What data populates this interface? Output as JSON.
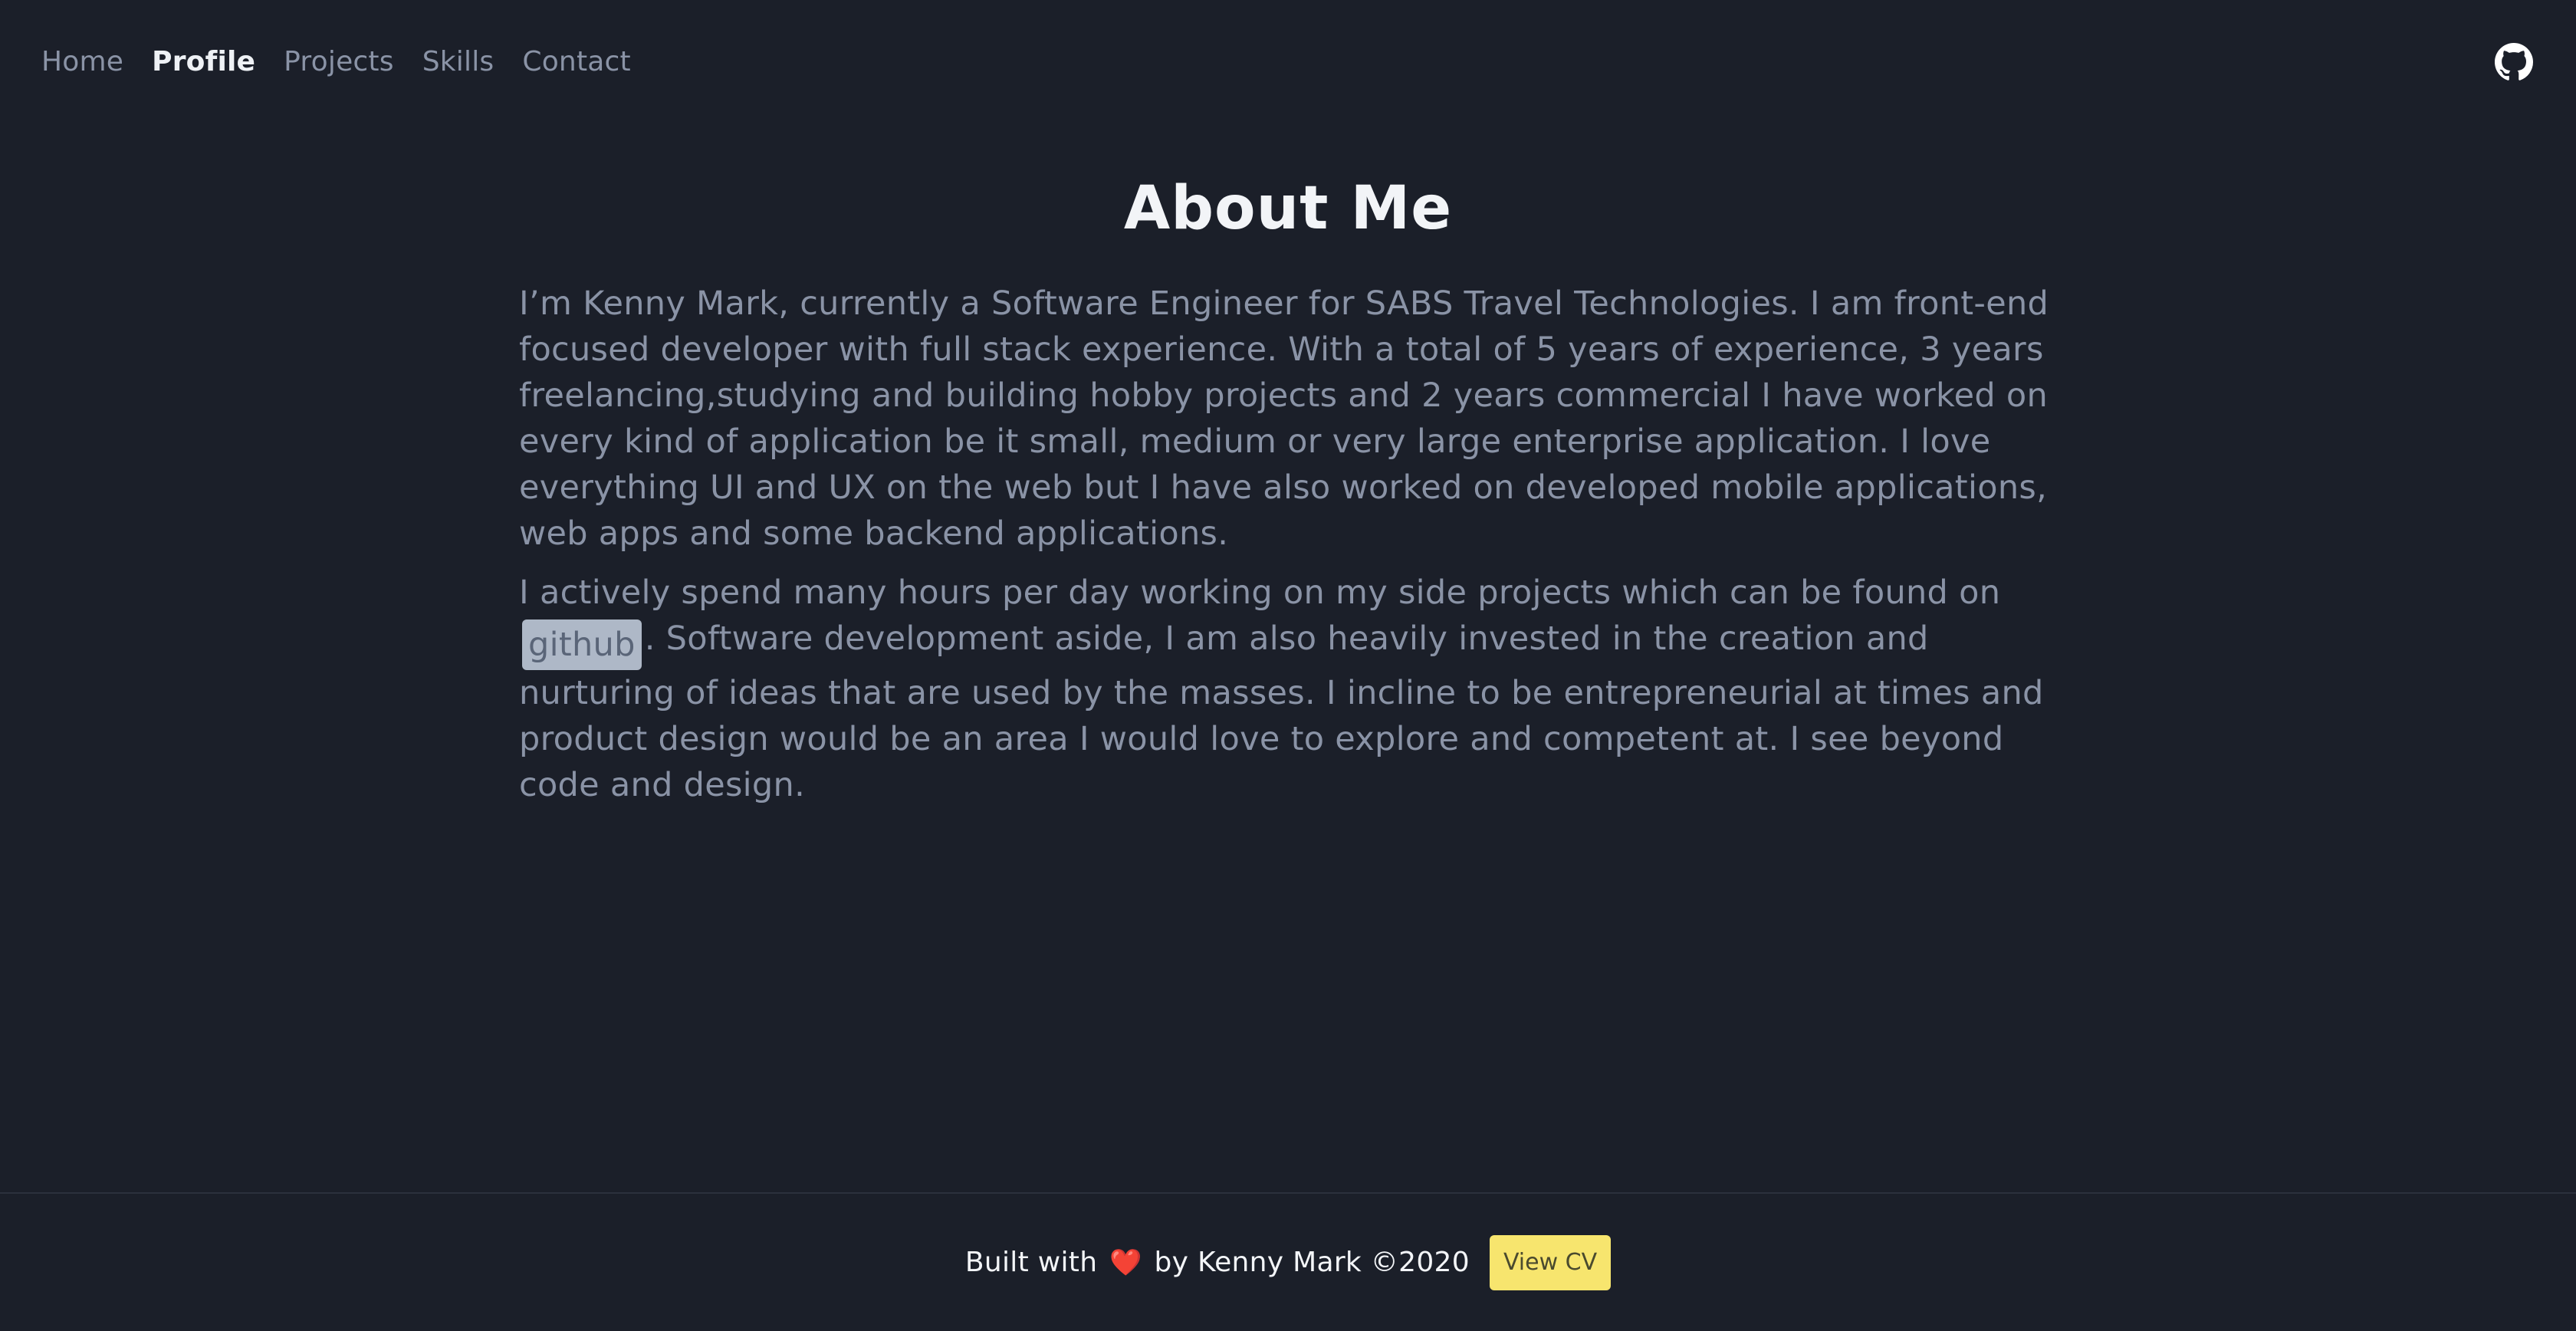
{
  "nav": {
    "items": [
      {
        "label": "Home",
        "active": false
      },
      {
        "label": "Profile",
        "active": true
      },
      {
        "label": "Projects",
        "active": false
      },
      {
        "label": "Skills",
        "active": false
      },
      {
        "label": "Contact",
        "active": false
      }
    ],
    "github_icon": "github-icon"
  },
  "main": {
    "title": "About Me",
    "paragraph1": "I’m Kenny Mark, currently a Software Engineer for SABS Travel Technologies. I am front-end focused developer with full stack experience. With a total of 5 years of experience, 3 years freelancing,studying and building hobby projects and 2 years commercial I have worked on every kind of application be it small, medium or very large enterprise application. I love everything UI and UX on the web but I have also worked on developed mobile applications, web apps and some backend applications.",
    "paragraph2_before": "I actively spend many hours per day working on my side projects which can be found on",
    "github_link": "github",
    "paragraph2_after": ". Software development aside, I am also heavily invested in the creation and nurturing of ideas that are used by the masses. I incline to be entrepreneurial at times and product design would be an area I would love to explore and competent at. I see beyond code and design."
  },
  "footer": {
    "built_prefix": "Built with",
    "heart": "❤️",
    "built_suffix": "by Kenny Mark ©2020",
    "cv_button": "View CV"
  },
  "colors": {
    "background": "#1b1f29",
    "text_muted": "#8a93a6",
    "accent_button": "#f7e56e"
  }
}
